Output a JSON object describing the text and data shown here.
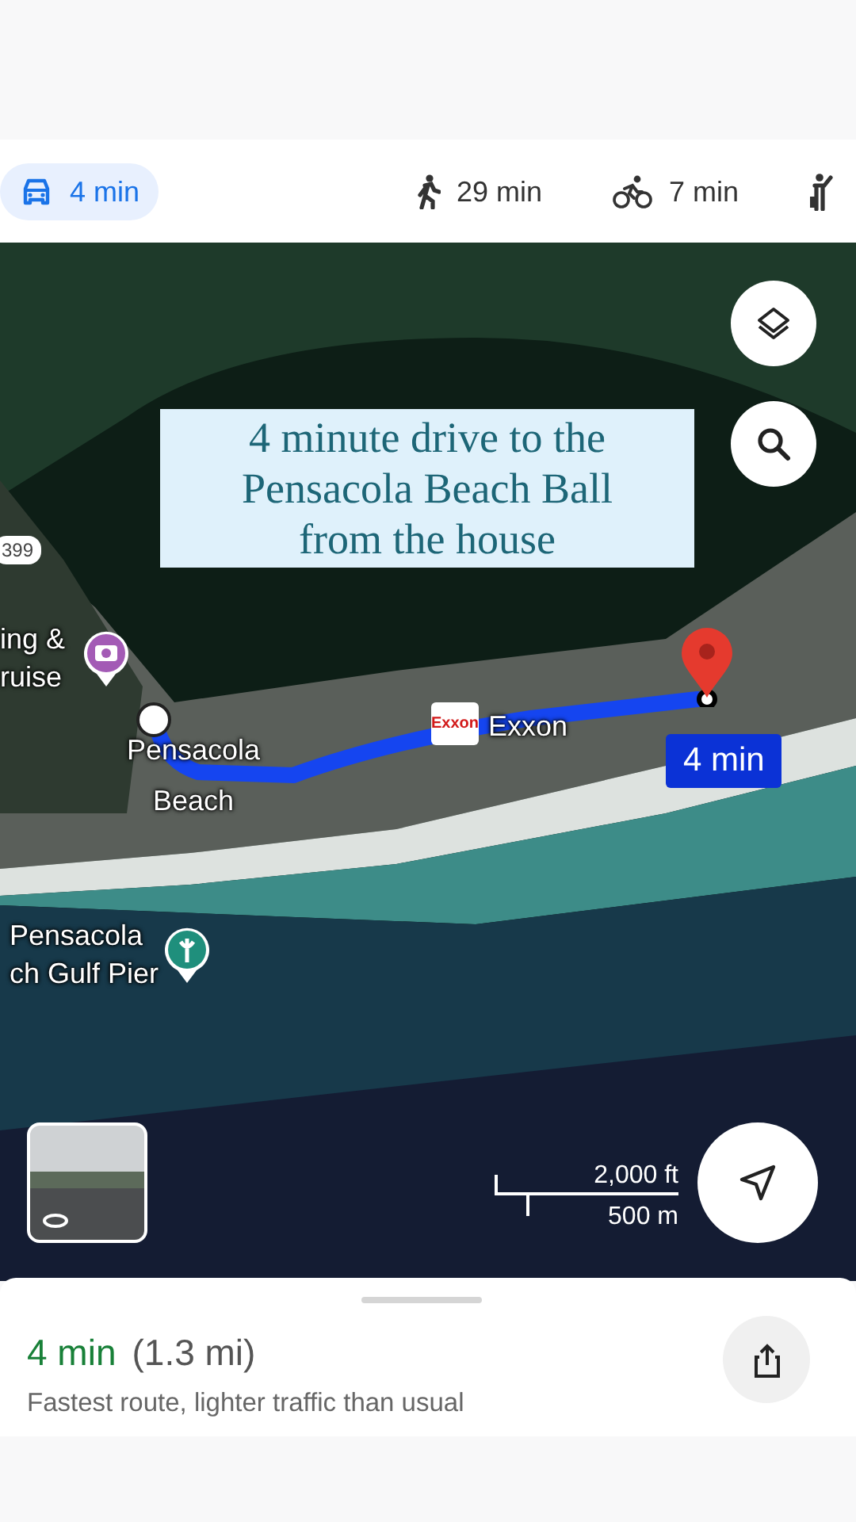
{
  "travel_modes": [
    {
      "kind": "drive",
      "label": "4 min",
      "selected": true
    },
    {
      "kind": "walk",
      "label": "29 min",
      "selected": false
    },
    {
      "kind": "bike",
      "label": "7 min",
      "selected": false
    },
    {
      "kind": "ride",
      "selected": false
    }
  ],
  "map": {
    "caption": "4 minute drive to the Pensacola Beach Ball from the house",
    "road_shield": "399",
    "places": [
      {
        "kind": "camera",
        "lines": [
          "ing &",
          "ruise"
        ]
      },
      {
        "kind": "origin",
        "lines": [
          "Pensacola",
          "Beach"
        ]
      },
      {
        "kind": "gas",
        "logo": "Exxon",
        "lines": [
          "Exxon"
        ]
      },
      {
        "kind": "pier",
        "lines": [
          "Pensacola",
          "ch Gulf Pier"
        ]
      }
    ],
    "route_badge": "4 min",
    "scale": {
      "imperial": "2,000 ft",
      "metric": "500 m"
    }
  },
  "sheet": {
    "duration": "4 min",
    "distance": "(1.3 mi)",
    "summary": "Fastest route, lighter traffic than usual"
  }
}
